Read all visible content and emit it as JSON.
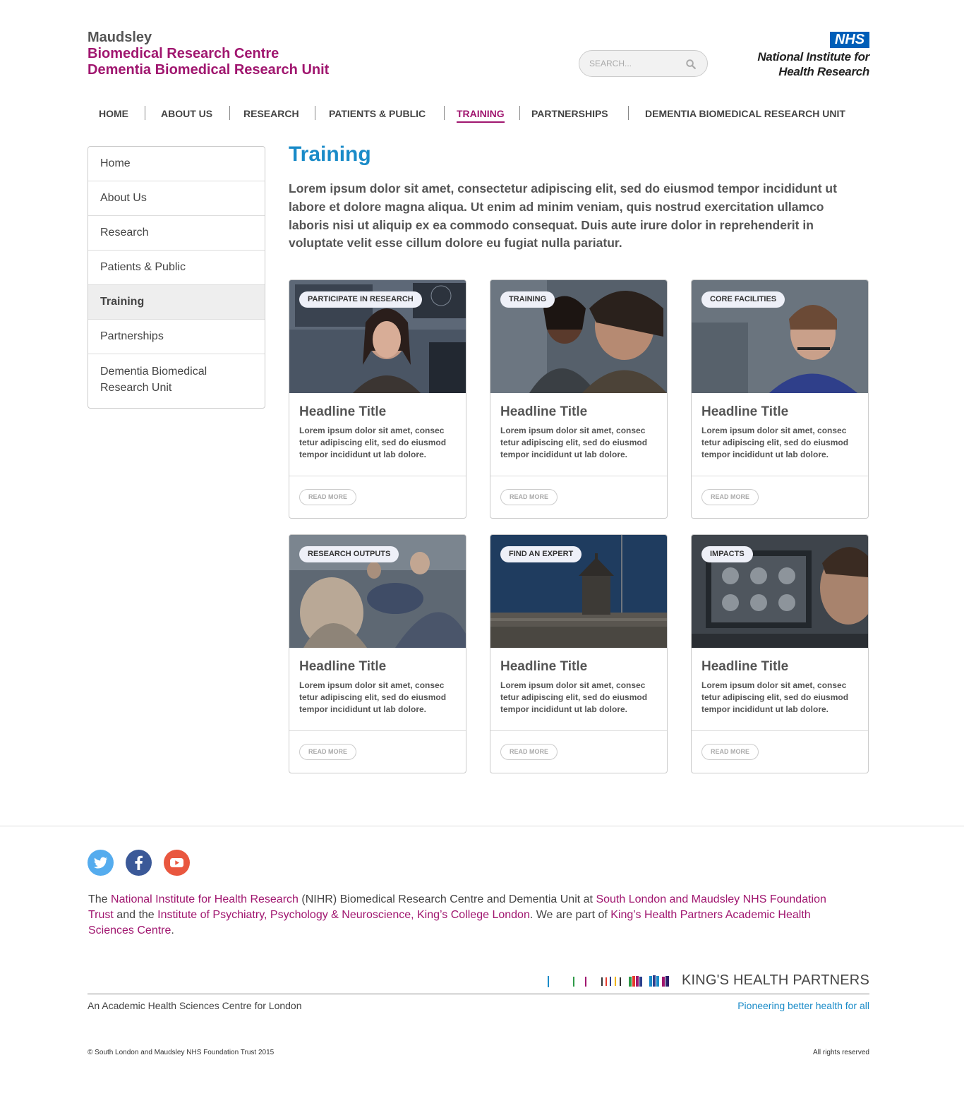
{
  "brand": {
    "line1": "Maudsley",
    "line2": "Biomedical Research Centre",
    "line3": "Dementia Biomedical Research Unit"
  },
  "search": {
    "placeholder": "SEARCH...",
    "icon": "search-icon"
  },
  "nihr": {
    "badge": "NHS",
    "line1": "National Institute for",
    "line2": "Health Research"
  },
  "nav": {
    "items": [
      {
        "label": "HOME"
      },
      {
        "label": "ABOUT US"
      },
      {
        "label": "RESEARCH"
      },
      {
        "label": "PATIENTS & PUBLIC"
      },
      {
        "label": "TRAINING",
        "active": true
      },
      {
        "label": "PARTNERSHIPS"
      },
      {
        "label": "DEMENTIA BIOMEDICAL RESEARCH UNIT"
      }
    ]
  },
  "sidebar": {
    "items": [
      {
        "label": "Home"
      },
      {
        "label": "About Us"
      },
      {
        "label": "Research"
      },
      {
        "label": "Patients & Public"
      },
      {
        "label": "Training",
        "active": true
      },
      {
        "label": "Partnerships"
      },
      {
        "label": "Dementia Biomedical Research Unit"
      }
    ]
  },
  "main": {
    "title": "Training",
    "intro": "Lorem ipsum dolor sit amet, consectetur adipiscing elit, sed do eiusmod tempor incididunt ut labore et dolore magna aliqua. Ut enim ad minim veniam, quis nostrud exercitation ullamco laboris nisi ut aliquip ex ea commodo consequat. Duis aute irure dolor in reprehenderit in voluptate velit esse cillum dolore eu fugiat nulla pariatur.",
    "cards": [
      {
        "tag": "PARTICIPATE IN RESEARCH",
        "title": "Headline Title",
        "text": "Lorem ipsum dolor sit amet, consec tetur adipiscing elit, sed do eiusmod tempor incididunt ut lab dolore.",
        "button": "READ MORE"
      },
      {
        "tag": "TRAINING",
        "title": "Headline Title",
        "text": "Lorem ipsum dolor sit amet, consec tetur adipiscing elit, sed do eiusmod tempor incididunt ut lab dolore.",
        "button": "READ MORE"
      },
      {
        "tag": "CORE FACILITIES",
        "title": "Headline Title",
        "text": "Lorem ipsum dolor sit amet, consec tetur adipiscing elit, sed do eiusmod tempor incididunt ut lab dolore.",
        "button": "READ MORE"
      },
      {
        "tag": "RESEARCH OUTPUTS",
        "title": "Headline Title",
        "text": "Lorem ipsum dolor sit amet, consec tetur adipiscing elit, sed do eiusmod tempor incididunt ut lab dolore.",
        "button": "READ MORE"
      },
      {
        "tag": "FIND AN EXPERT",
        "title": "Headline Title",
        "text": "Lorem ipsum dolor sit amet, consec tetur adipiscing elit, sed do eiusmod tempor incididunt ut lab dolore.",
        "button": "READ MORE"
      },
      {
        "tag": "IMPACTS",
        "title": "Headline Title",
        "text": "Lorem ipsum dolor sit amet, consec tetur adipiscing elit, sed do eiusmod tempor incididunt ut lab dolore.",
        "button": "READ MORE"
      }
    ]
  },
  "footer": {
    "social": [
      {
        "icon": "twitter-icon",
        "color": "#55acee"
      },
      {
        "icon": "facebook-icon",
        "color": "#3b5998"
      },
      {
        "icon": "youtube-icon",
        "color": "#e9573f"
      }
    ],
    "text": {
      "p1": "The ",
      "link1": "National Institute for Health Research",
      "p2": " (NIHR) Biomedical Research Centre and Dementia Unit at ",
      "link2": "South London and Maudsley NHS Foundation Trust",
      "p3": " and the ",
      "link3": "Institute of Psychiatry, Psychology & Neuroscience, King’s College London",
      "p4": ". We are part of ",
      "link4": "King’s Health Partners Academic Health Sciences Centre",
      "p5": "."
    },
    "khp_name": "KING'S HEALTH PARTNERS",
    "khp_left": "An Academic Health Sciences Centre for London",
    "khp_right": "Pioneering better health for all",
    "copyright": "© South London and Maudsley NHS Foundation Trust 2015",
    "rights": "All rights reserved"
  },
  "colors": {
    "brand_magenta": "#a0166f",
    "title_blue": "#1a8bc8",
    "nhs_blue": "#005eb8"
  }
}
